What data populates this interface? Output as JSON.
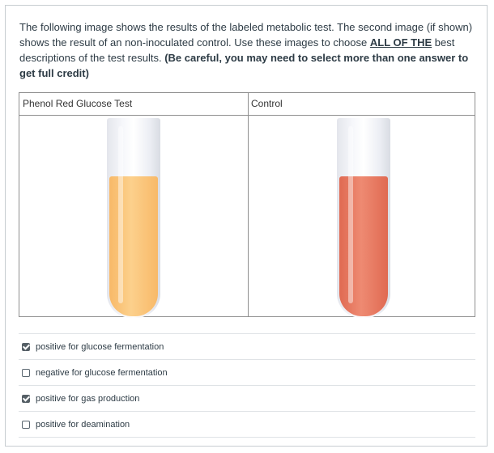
{
  "question": {
    "line_a": "The following image shows the results of the labeled metabolic test. The second image (if shown) shows the result of an non-inoculated control.  Use these images to choose ",
    "emphasis": "ALL OF THE",
    "line_b": " best descriptions of the test results. ",
    "warning": "(Be careful, you may need to select more than one answer to get full credit)"
  },
  "table": {
    "left_header": "Phenol Red Glucose Test",
    "right_header": "Control"
  },
  "colors": {
    "test_liquid": "#f8b968",
    "control_liquid": "#e06a52"
  },
  "answers": [
    {
      "label": "positive for glucose fermentation",
      "checked": true
    },
    {
      "label": "negative for glucose fermentation",
      "checked": false
    },
    {
      "label": "positive for gas production",
      "checked": true
    },
    {
      "label": "positive for deamination",
      "checked": false
    }
  ]
}
